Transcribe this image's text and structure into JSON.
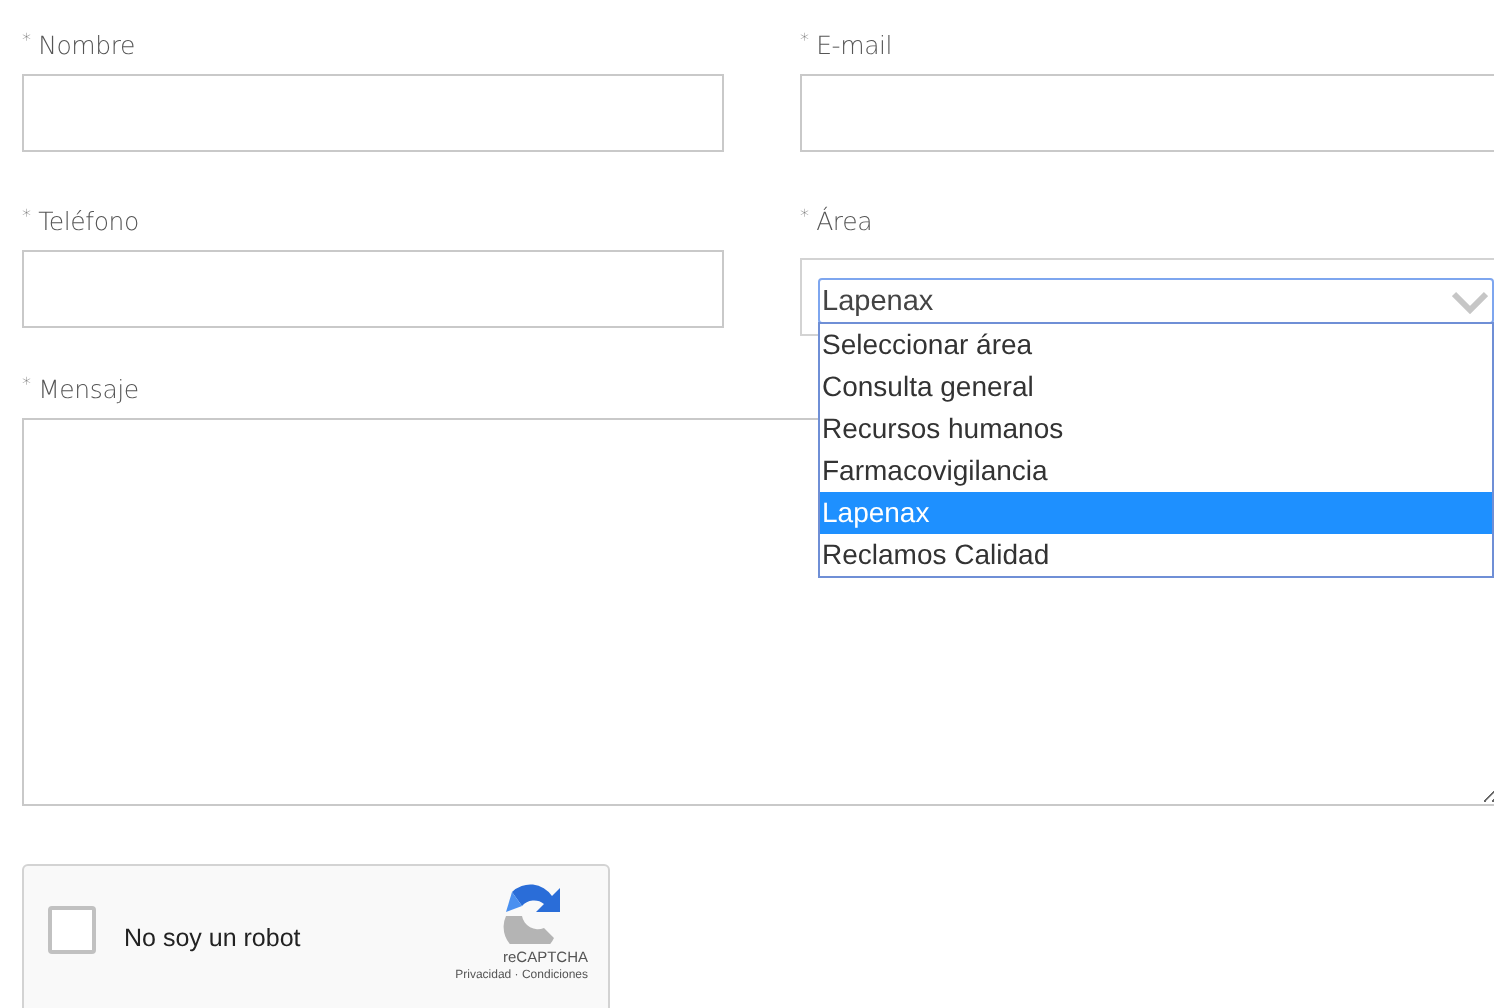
{
  "fields": [
    {
      "label": "Nombre",
      "mark": "*"
    },
    {
      "label": "E-mail",
      "mark": "*"
    },
    {
      "label": "Teléfono",
      "mark": "*"
    }
  ],
  "area": {
    "label": "Área",
    "mark": "*",
    "value": "Lapenax",
    "expanded": true,
    "options": [
      {
        "label": "Seleccionar área",
        "selected": false
      },
      {
        "label": "Consulta general",
        "selected": false
      },
      {
        "label": "Recursos humanos",
        "selected": false
      },
      {
        "label": "Farmacovigilancia",
        "selected": false
      },
      {
        "label": "Lapenax",
        "selected": true
      },
      {
        "label": "Reclamos Calidad",
        "selected": false
      }
    ]
  },
  "message": {
    "label": "Mensaje",
    "mark": "*"
  },
  "captcha": {
    "label": "No soy un robot",
    "checked": false,
    "brand": "reCAPTCHA",
    "privacy": "Privacidad",
    "separator": "·",
    "terms": "Condiciones"
  }
}
